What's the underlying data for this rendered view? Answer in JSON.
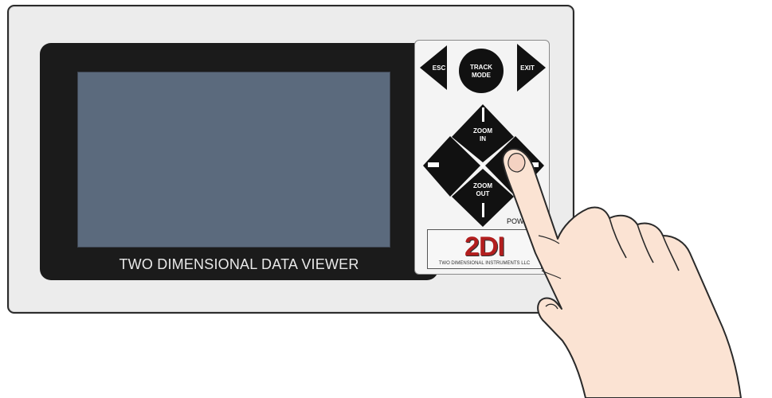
{
  "device": {
    "caption": "TWO DIMENSIONAL DATA VIEWER",
    "screen_color": "#5b6a7d"
  },
  "keypad": {
    "esc_label": "ESC",
    "track_mode_line1": "TRACK",
    "track_mode_line2": "MODE",
    "exit_label": "EXIT",
    "zoom_in_line1": "ZOOM",
    "zoom_in_line2": "IN",
    "zoom_out_line1": "ZOOM",
    "zoom_out_line2": "OUT",
    "power_label": "POWER"
  },
  "logo": {
    "text": "2DI",
    "tagline": "TWO DIMENSIONAL INSTRUMENTS LLC"
  },
  "colors": {
    "key": "#111111",
    "logo_red": "#b21e1e",
    "skin": "#fbe3d3"
  }
}
